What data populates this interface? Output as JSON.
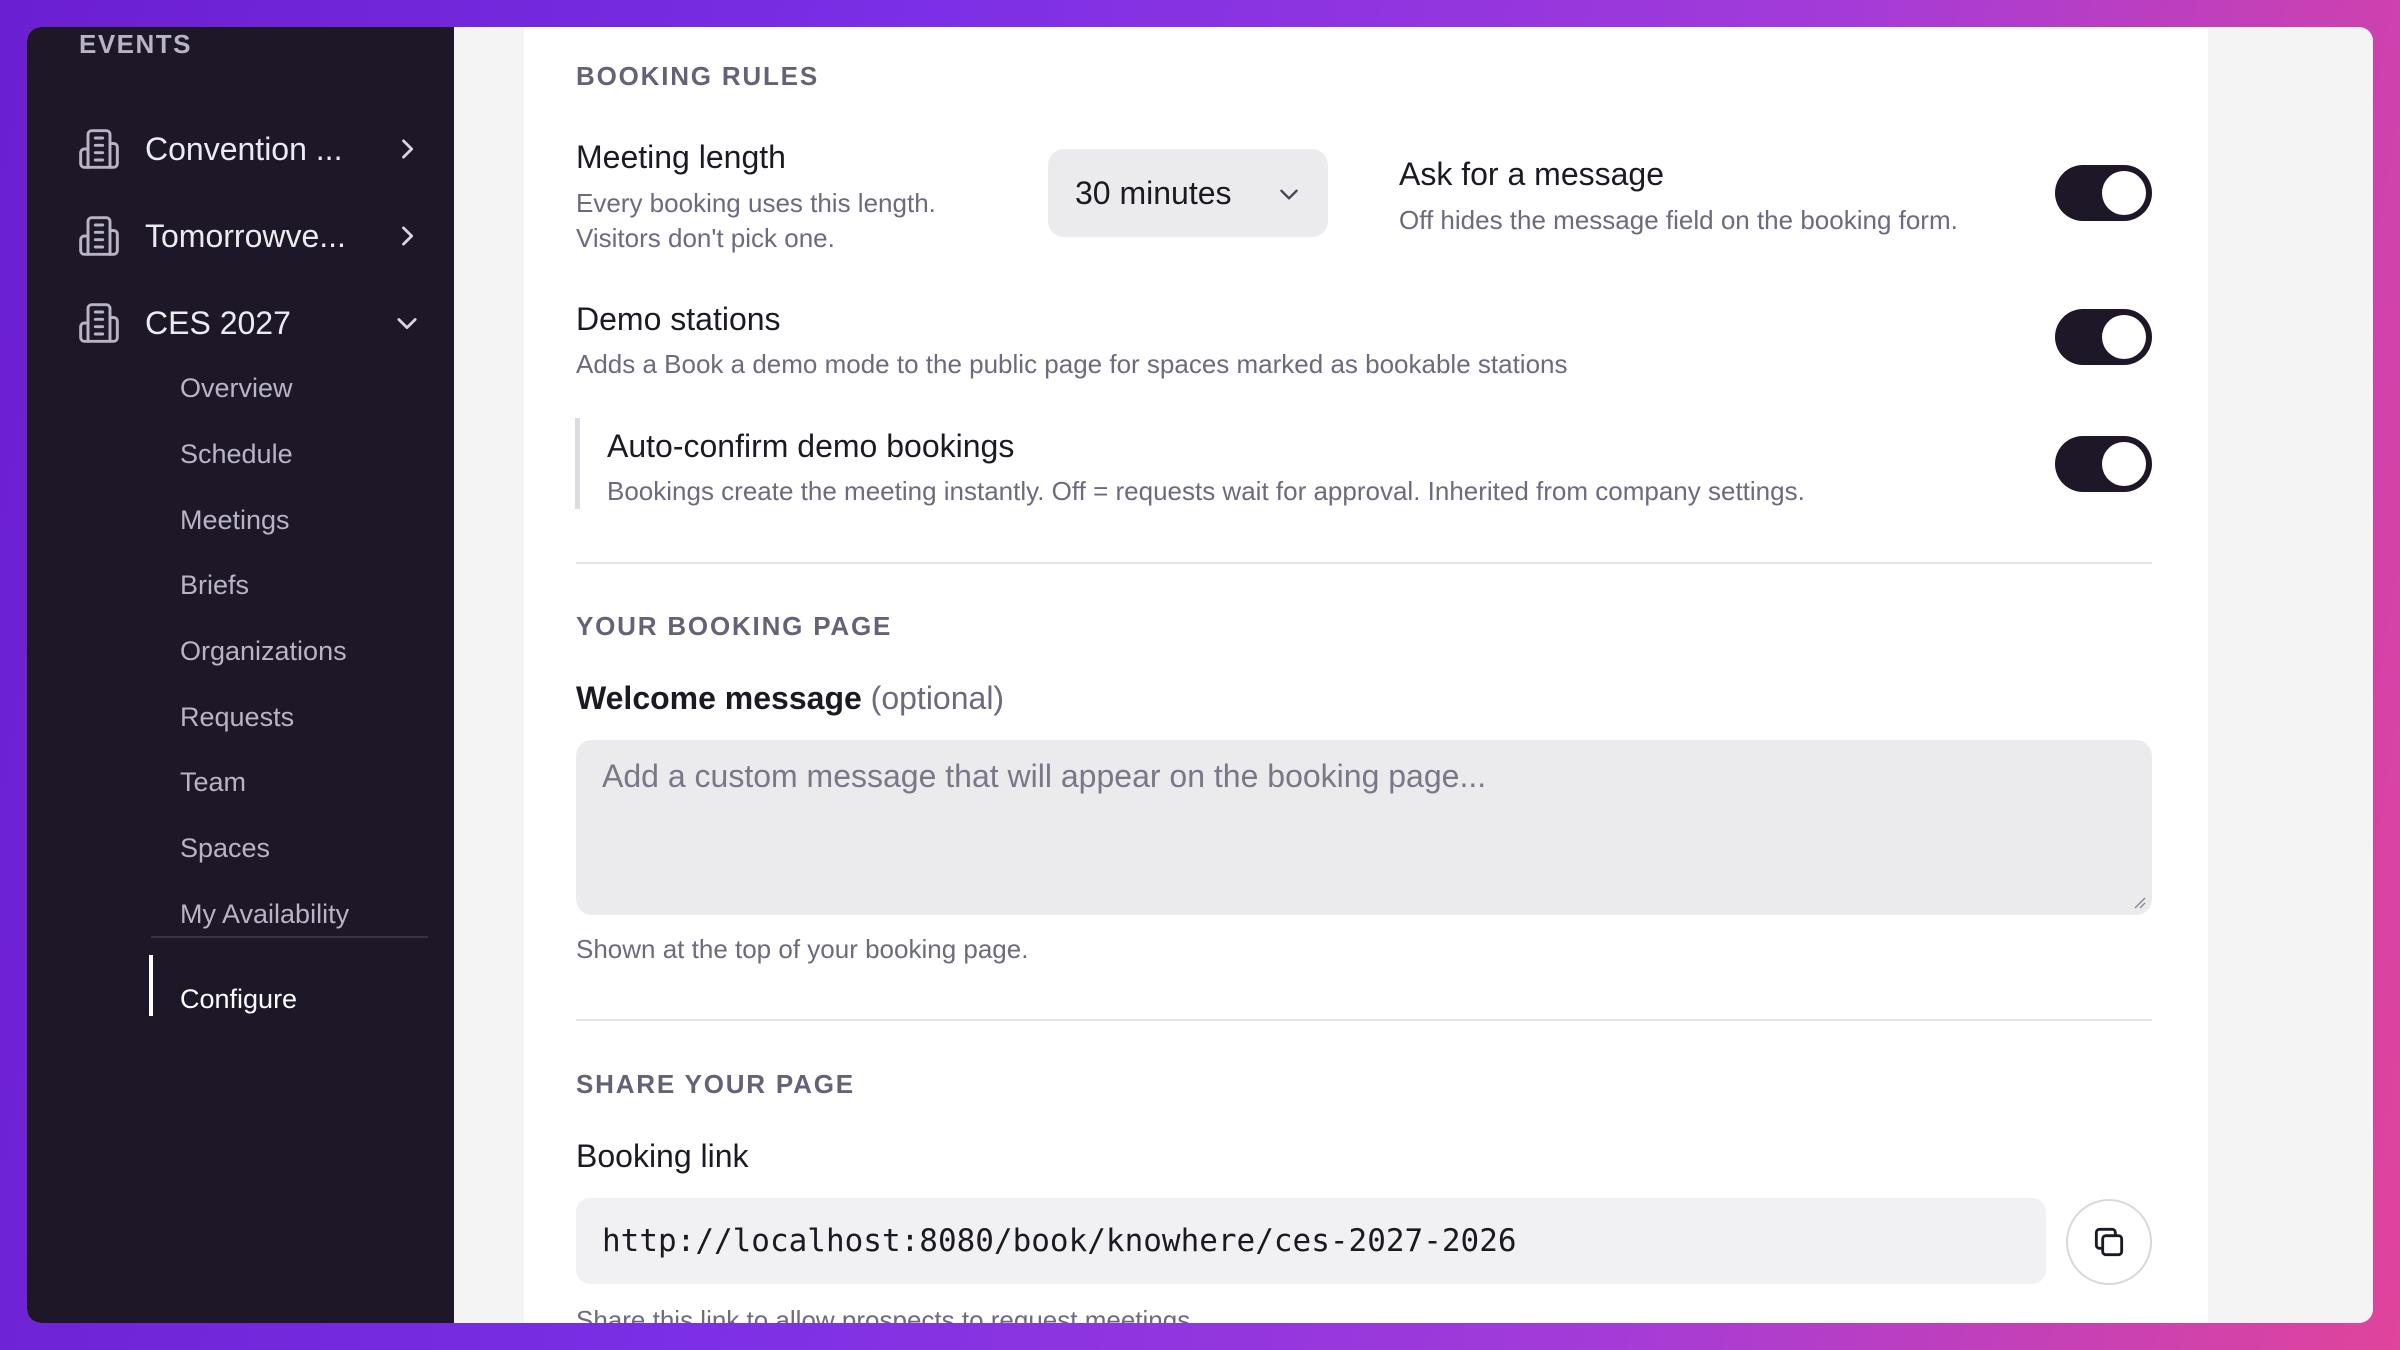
{
  "sidebar": {
    "heading": "EVENTS",
    "events": [
      {
        "label": "Convention ...",
        "icon": "building-icon",
        "expanded": false
      },
      {
        "label": "Tomorrowve...",
        "icon": "building-icon",
        "expanded": false
      },
      {
        "label": "CES 2027",
        "icon": "building-icon",
        "expanded": true
      }
    ],
    "sub_items": [
      "Overview",
      "Schedule",
      "Meetings",
      "Briefs",
      "Organizations",
      "Requests",
      "Team",
      "Spaces",
      "My Availability"
    ],
    "active_item": "Configure"
  },
  "booking_rules": {
    "title": "BOOKING RULES",
    "meeting_length": {
      "label": "Meeting length",
      "desc_line1": "Every booking uses this length.",
      "desc_line2": "Visitors don't pick one.",
      "value": "30 minutes"
    },
    "ask_message": {
      "label": "Ask for a message",
      "desc": "Off hides the message field on the booking form.",
      "enabled": true
    },
    "demo_stations": {
      "label": "Demo stations",
      "desc": "Adds a Book a demo mode to the public page for spaces marked as bookable stations",
      "enabled": true
    },
    "auto_confirm": {
      "label": "Auto-confirm demo bookings",
      "desc": "Bookings create the meeting instantly. Off = requests wait for approval. Inherited from company settings.",
      "enabled": true
    }
  },
  "booking_page": {
    "title": "YOUR BOOKING PAGE",
    "welcome_label": "Welcome message",
    "welcome_optional": "(optional)",
    "welcome_placeholder": "Add a custom message that will appear on the booking page...",
    "welcome_help": "Shown at the top of your booking page."
  },
  "share": {
    "title": "SHARE YOUR PAGE",
    "link_label": "Booking link",
    "link_value": "http://localhost:8080/book/knowhere/ces-2027-2026",
    "link_help": "Share this link to allow prospects to request meetings"
  }
}
